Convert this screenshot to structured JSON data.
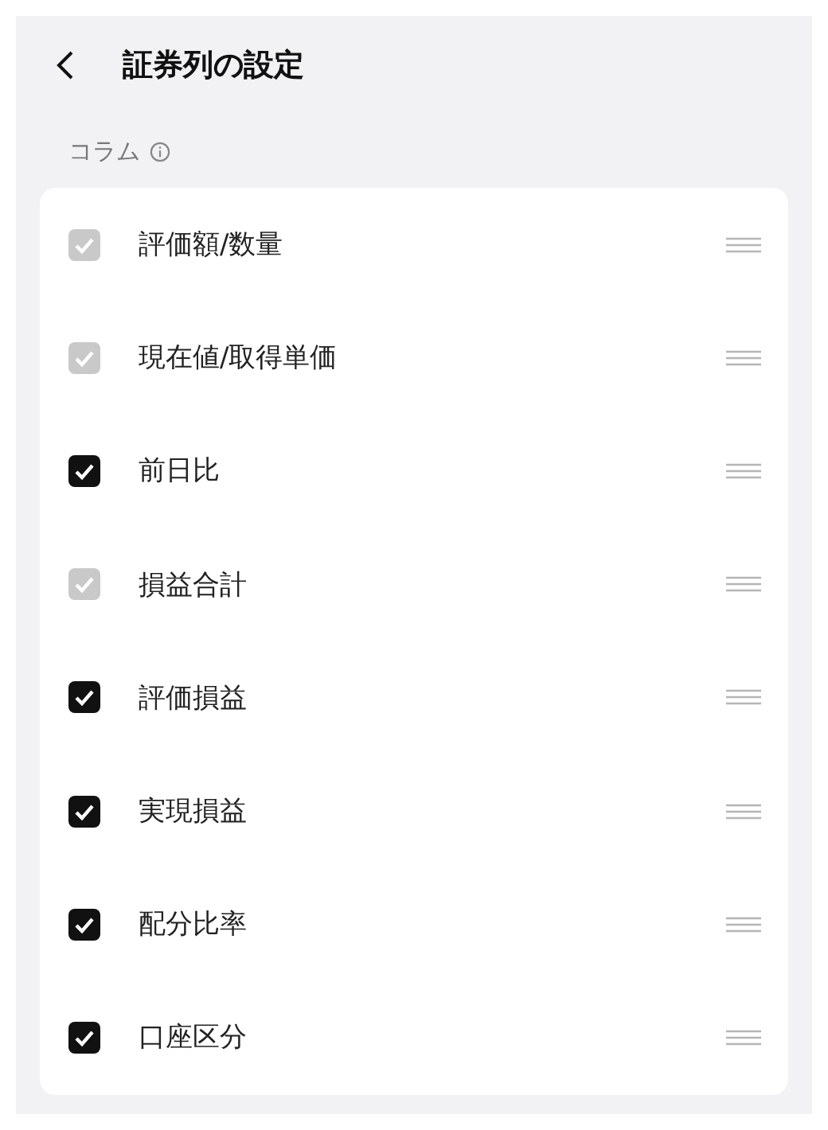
{
  "header": {
    "title": "証券列の設定"
  },
  "section": {
    "label": "コラム"
  },
  "columns": [
    {
      "label": "評価額/数量",
      "checked": true,
      "disabled": true
    },
    {
      "label": "現在値/取得単価",
      "checked": true,
      "disabled": true
    },
    {
      "label": "前日比",
      "checked": true,
      "disabled": false
    },
    {
      "label": "損益合計",
      "checked": true,
      "disabled": true
    },
    {
      "label": "評価損益",
      "checked": true,
      "disabled": false
    },
    {
      "label": "実現損益",
      "checked": true,
      "disabled": false
    },
    {
      "label": "配分比率",
      "checked": true,
      "disabled": false
    },
    {
      "label": "口座区分",
      "checked": true,
      "disabled": false
    }
  ]
}
